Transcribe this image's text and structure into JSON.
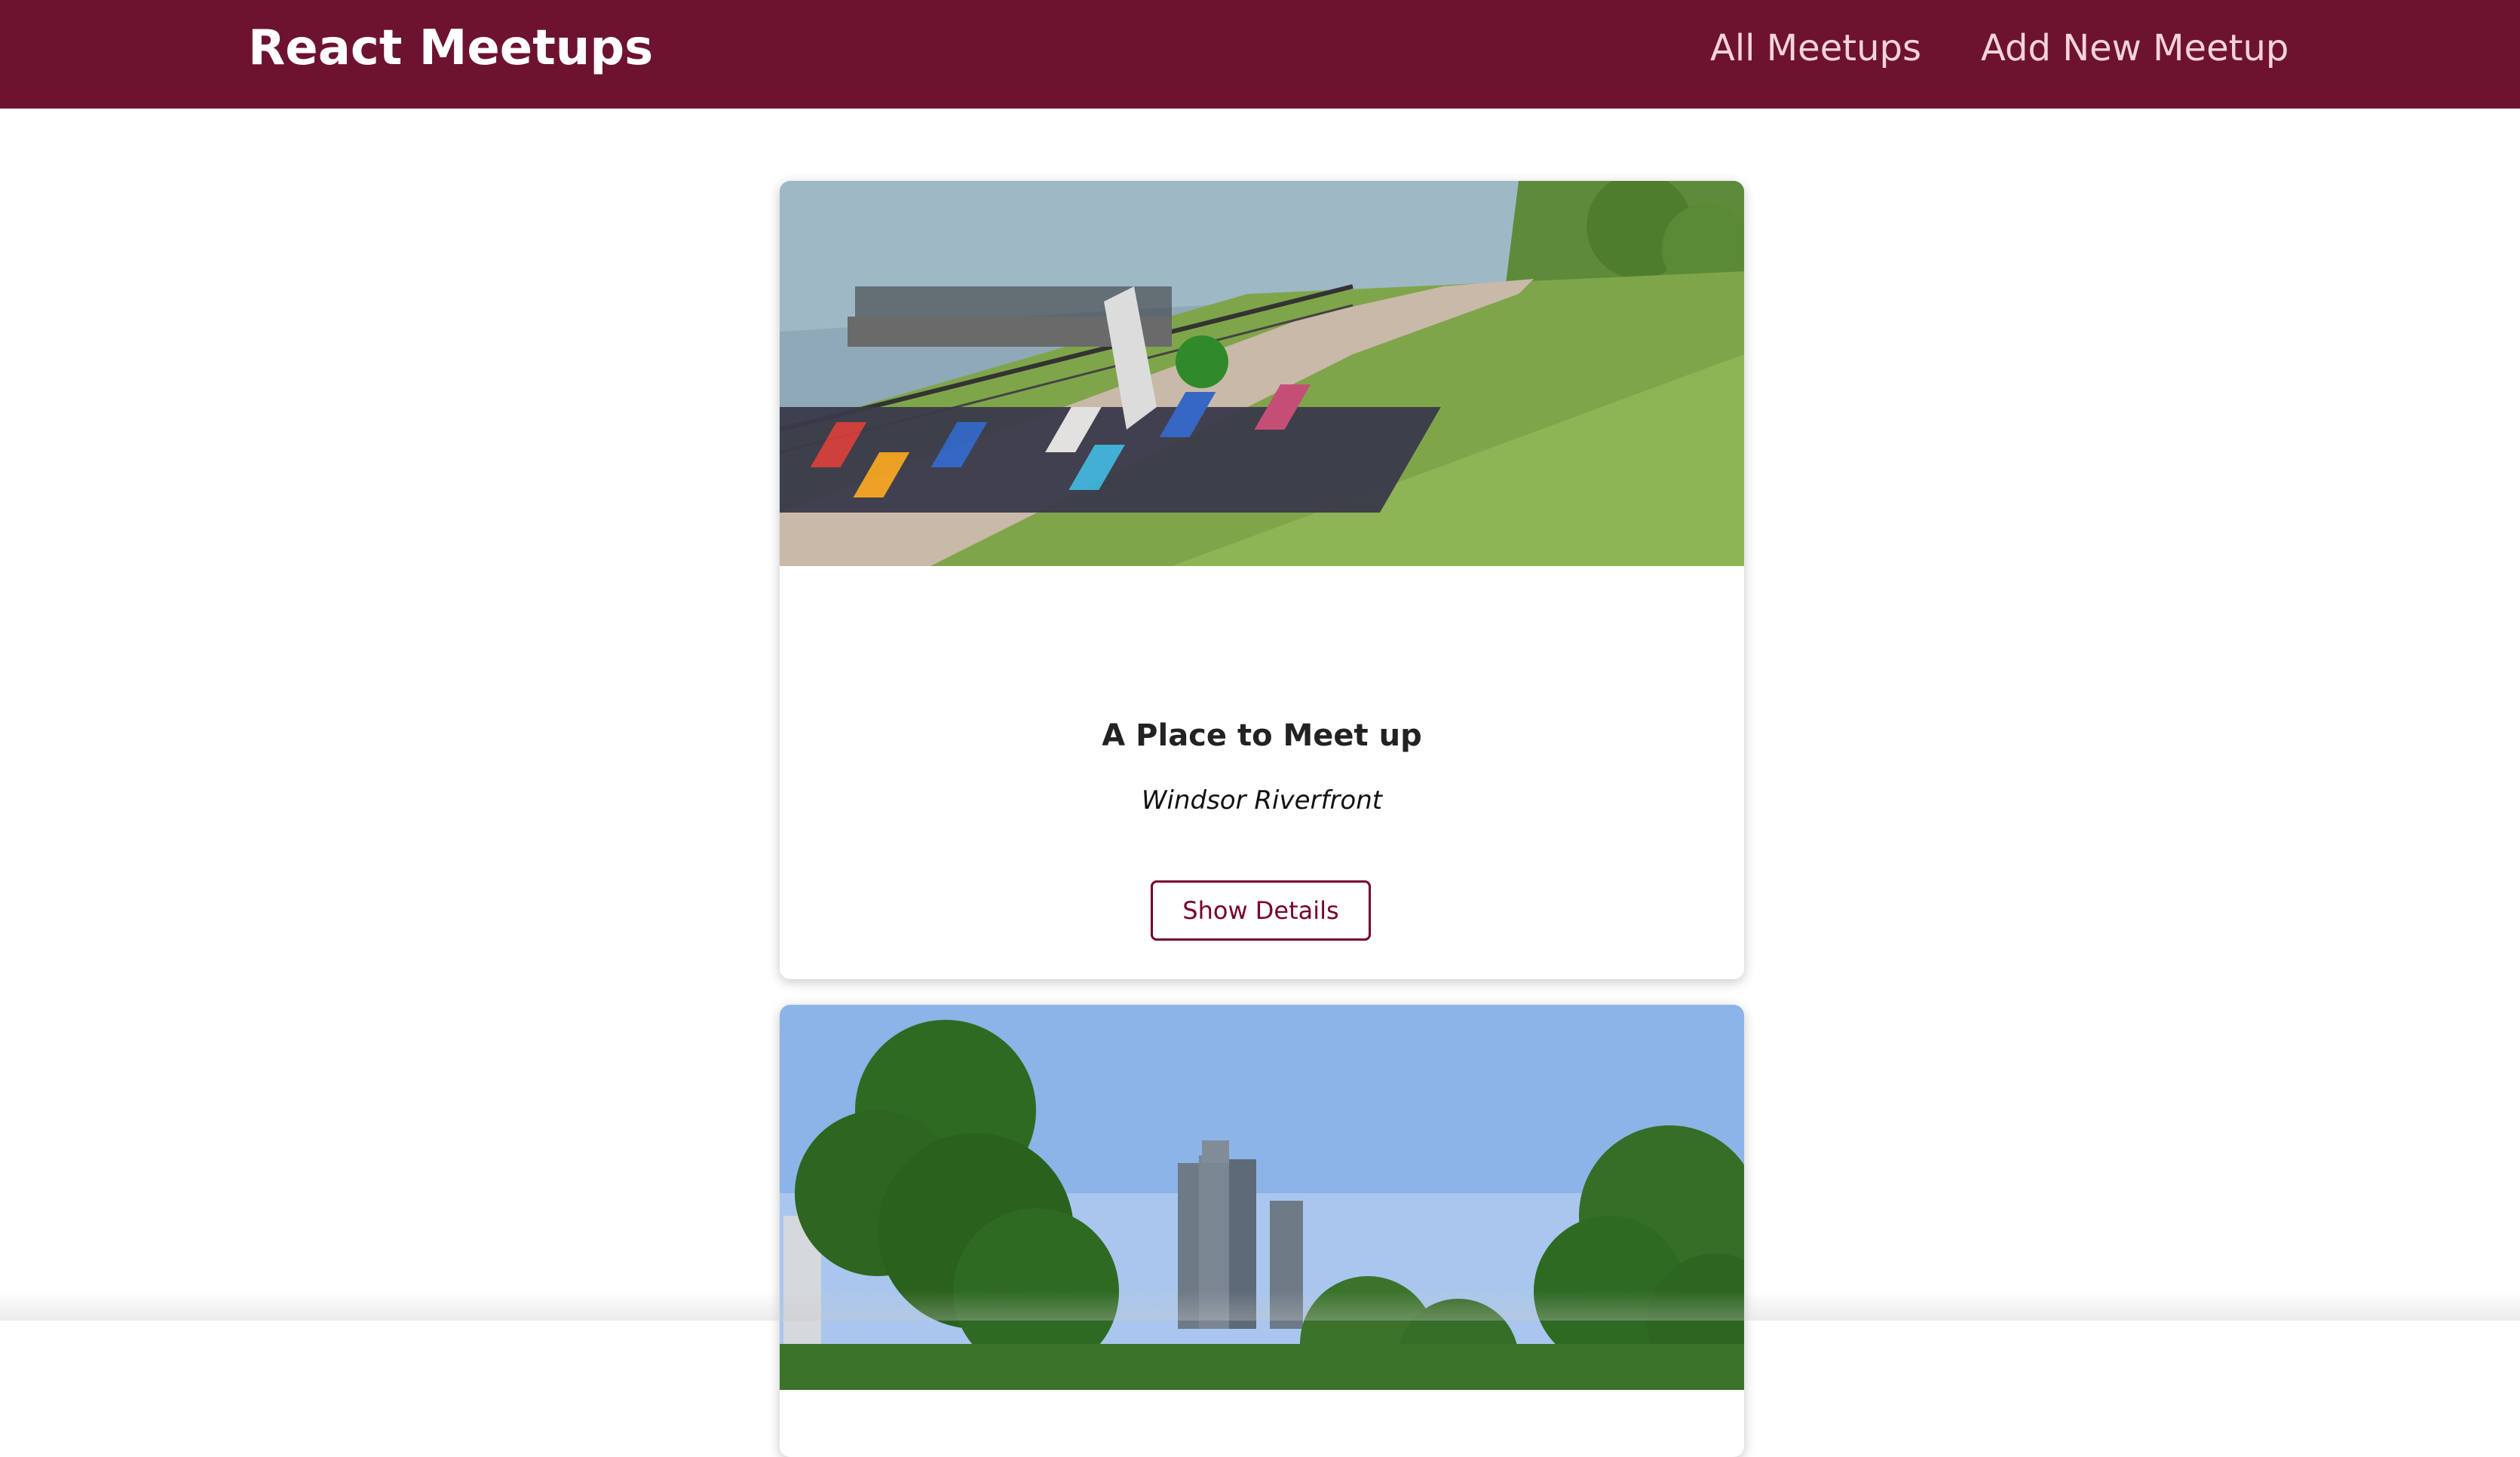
{
  "header": {
    "logo": "React Meetups",
    "nav": [
      {
        "label": "All Meetups"
      },
      {
        "label": "Add New Meetup"
      }
    ]
  },
  "meetups": [
    {
      "title": "A Place to Meet up",
      "address": "Windsor Riverfront",
      "button_label": "Show Details",
      "image": "riverfront-crowd-photo"
    },
    {
      "image": "detroit-skyline-photo"
    }
  ],
  "colors": {
    "header_bg": "#6d1330",
    "accent": "#77002e"
  }
}
